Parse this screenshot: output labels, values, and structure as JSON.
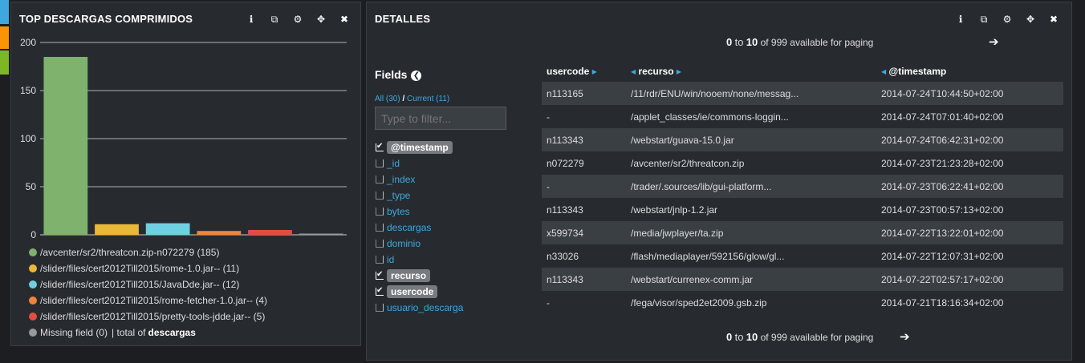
{
  "colors": {
    "stripe_top": "#3ea8de",
    "stripe_mid": "#f89406",
    "stripe_bot": "#7eb726",
    "series": [
      "#7eb26d",
      "#eab839",
      "#6ed0e0",
      "#ef843c",
      "#e24d42",
      "#999999"
    ]
  },
  "left_panel": {
    "title": "TOP DESCARGAS COMPRIMIDOS",
    "icons": [
      "info-icon",
      "copy-icon",
      "gear-icon",
      "move-icon",
      "close-icon"
    ]
  },
  "chart_data": {
    "type": "bar",
    "categories": [
      "/avcenter/sr2/threatcon.zip-n072279",
      "/slider/files/cert2012Till2015/rome-1.0.jar--",
      "/slider/files/cert2012Till2015/JavaDde.jar--",
      "/slider/files/cert2012Till2015/rome-fetcher-1.0.jar--",
      "/slider/files/cert2012Till2015/pretty-tools-jdde.jar--",
      "Missing field"
    ],
    "values": [
      185,
      11,
      12,
      4,
      5,
      0
    ],
    "yticks": [
      "0",
      "50",
      "100",
      "150",
      "200"
    ],
    "ylim": [
      0,
      200
    ],
    "grid": true
  },
  "legend": {
    "items": [
      "/avcenter/sr2/threatcon.zip-n072279 (185)",
      "/slider/files/cert2012Till2015/rome-1.0.jar-- (11)",
      "/slider/files/cert2012Till2015/JavaDde.jar-- (12)",
      "/slider/files/cert2012Till2015/rome-fetcher-1.0.jar-- (4)",
      "/slider/files/cert2012Till2015/pretty-tools-jdde.jar-- (5)",
      "Missing field (0)"
    ],
    "total_prefix": "| total of",
    "total_field": "descargas"
  },
  "right_panel": {
    "title": "DETALLES",
    "icons": [
      "info-icon",
      "copy-icon",
      "gear-icon",
      "move-icon",
      "close-icon"
    ],
    "paging": {
      "from": "0",
      "to_word": "to",
      "to": "10",
      "rest": "of 999 available for paging"
    },
    "fields": {
      "title": "Fields",
      "all_label": "All (30)",
      "separator": "/",
      "current_label": "Current (11)",
      "filter_placeholder": "Type to filter...",
      "items": [
        {
          "name": "@timestamp",
          "checked": true
        },
        {
          "name": "_id",
          "checked": false
        },
        {
          "name": "_index",
          "checked": false
        },
        {
          "name": "_type",
          "checked": false
        },
        {
          "name": "bytes",
          "checked": false
        },
        {
          "name": "descargas",
          "checked": false
        },
        {
          "name": "dominio",
          "checked": false
        },
        {
          "name": "id",
          "checked": false
        },
        {
          "name": "recurso",
          "checked": true
        },
        {
          "name": "usercode",
          "checked": true
        },
        {
          "name": "usuario_descarga",
          "checked": false
        }
      ]
    },
    "table": {
      "headers": [
        "usercode",
        "recurso",
        "@timestamp"
      ],
      "rows": [
        [
          "n113165",
          "/11/rdr/ENU/win/nooem/none/messag...",
          "2014-07-24T10:44:50+02:00"
        ],
        [
          "-",
          "/applet_classes/ie/commons-loggin...",
          "2014-07-24T07:01:40+02:00"
        ],
        [
          "n113343",
          "/webstart/guava-15.0.jar",
          "2014-07-24T06:42:31+02:00"
        ],
        [
          "n072279",
          "/avcenter/sr2/threatcon.zip",
          "2014-07-23T21:23:28+02:00"
        ],
        [
          "-",
          "/trader/.sources/lib/gui-platform...",
          "2014-07-23T06:22:41+02:00"
        ],
        [
          "n113343",
          "/webstart/jnlp-1.2.jar",
          "2014-07-23T00:57:13+02:00"
        ],
        [
          "x599734",
          "/media/jwplayer/ta.zip",
          "2014-07-22T13:22:01+02:00"
        ],
        [
          "n33026",
          "/flash/mediaplayer/592156/glow/gl...",
          "2014-07-22T12:07:31+02:00"
        ],
        [
          "n113343",
          "/webstart/currenex-comm.jar",
          "2014-07-22T02:57:17+02:00"
        ],
        [
          "-",
          "/fega/visor/sped2et2009.gsb.zip",
          "2014-07-21T18:16:34+02:00"
        ]
      ]
    }
  }
}
